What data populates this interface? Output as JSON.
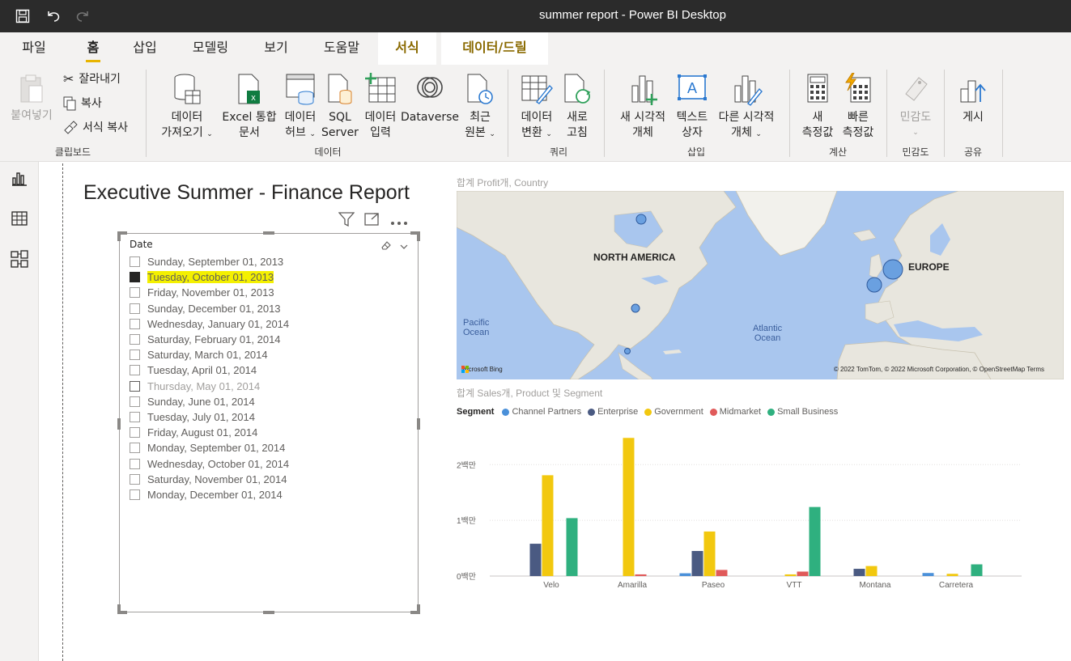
{
  "window": {
    "title": "summer report - Power BI Desktop"
  },
  "tabs": [
    {
      "label": "파일"
    },
    {
      "label": "홈"
    },
    {
      "label": "삽입"
    },
    {
      "label": "모델링"
    },
    {
      "label": "보기"
    },
    {
      "label": "도움말"
    },
    {
      "label": "서식"
    },
    {
      "label": "데이터/드릴"
    }
  ],
  "ribbon": {
    "clipboard": {
      "paste_label": "붙여넣기",
      "cut_label": "잘라내기",
      "copy_label": "복사",
      "format_copy_label": "서식 복사",
      "group_label": "클립보드"
    },
    "data": {
      "get_data_l1": "데이터",
      "get_data_l2": "가져오기",
      "excel_l1": "Excel 통합",
      "excel_l2": "문서",
      "hub_l1": "데이터",
      "hub_l2": "허브",
      "sql_l1": "SQL",
      "sql_l2": "Server",
      "enter_l1": "데이터",
      "enter_l2": "입력",
      "dataverse": "Dataverse",
      "recent_l1": "최근",
      "recent_l2": "원본",
      "group_label": "데이터"
    },
    "query": {
      "transform_l1": "데이터",
      "transform_l2": "변환",
      "refresh_l1": "새로",
      "refresh_l2": "고침",
      "group_label": "쿼리"
    },
    "insert": {
      "newvis_l1": "새 시각적",
      "newvis_l2": "개체",
      "textbox_l1": "텍스트",
      "textbox_l2": "상자",
      "morevis_l1": "다른 시각적",
      "morevis_l2": "개체",
      "group_label": "삽입"
    },
    "calc": {
      "newmeasure_l1": "새",
      "newmeasure_l2": "측정값",
      "quick_l1": "빠른",
      "quick_l2": "측정값",
      "group_label": "계산"
    },
    "sensitivity": {
      "label": "민감도",
      "group_label": "민감도"
    },
    "share": {
      "publish_label": "게시",
      "group_label": "공유"
    }
  },
  "report": {
    "title": "Executive Summer - Finance Report"
  },
  "slicer": {
    "header": "Date",
    "items": [
      {
        "label": "Sunday, September 01, 2013",
        "checked": false
      },
      {
        "label": "Tuesday, October 01, 2013",
        "checked": true
      },
      {
        "label": "Friday, November 01, 2013",
        "checked": false
      },
      {
        "label": "Sunday, December 01, 2013",
        "checked": false
      },
      {
        "label": "Wednesday, January 01, 2014",
        "checked": false
      },
      {
        "label": "Saturday, February 01, 2014",
        "checked": false
      },
      {
        "label": "Saturday, March 01, 2014",
        "checked": false
      },
      {
        "label": "Tuesday, April 01, 2014",
        "checked": false
      },
      {
        "label": "Thursday, May 01, 2014",
        "checked": false
      },
      {
        "label": "Sunday, June 01, 2014",
        "checked": false
      },
      {
        "label": "Tuesday, July 01, 2014",
        "checked": false
      },
      {
        "label": "Friday, August 01, 2014",
        "checked": false
      },
      {
        "label": "Monday, September 01, 2014",
        "checked": false
      },
      {
        "label": "Wednesday, October 01, 2014",
        "checked": false
      },
      {
        "label": "Saturday, November 01, 2014",
        "checked": false
      },
      {
        "label": "Monday, December 01, 2014",
        "checked": false
      }
    ]
  },
  "map": {
    "title": "합계 Profit개, Country",
    "label_na": "NORTH AMERICA",
    "label_eu": "EUROPE",
    "pacific_l1": "Pacific",
    "pacific_l2": "Ocean",
    "atlantic_l1": "Atlantic",
    "atlantic_l2": "Ocean",
    "bing": "Microsoft Bing",
    "copyright": "© 2022 TomTom, © 2022 Microsoft Corporation, © OpenStreetMap  Terms"
  },
  "chart": {
    "title": "합계  Sales개, Product 및 Segment",
    "legend_title": "Segment"
  },
  "colors": {
    "accent": "#e8b400",
    "highlight": "#f4f000",
    "channel_partners": "#4a90d9",
    "enterprise": "#4a5a82",
    "government": "#f2c80f",
    "midmarket": "#e05a5a",
    "small_business": "#2fb07f"
  },
  "chart_data": {
    "type": "bar",
    "categories": [
      "Velo",
      "Amarilla",
      "Paseo",
      "VTT",
      "Montana",
      "Carretera"
    ],
    "y_ticks": [
      "0백만",
      "1백만",
      "2백만"
    ],
    "ylim": [
      0,
      2600000
    ],
    "series": [
      {
        "name": "Channel Partners",
        "color": "#4a90d9",
        "values": [
          0,
          0,
          50000,
          0,
          0,
          55000
        ]
      },
      {
        "name": "Enterprise",
        "color": "#4a5a82",
        "values": [
          580000,
          0,
          450000,
          0,
          130000,
          0
        ]
      },
      {
        "name": "Government",
        "color": "#f2c80f",
        "values": [
          1810000,
          2480000,
          800000,
          30000,
          180000,
          40000
        ]
      },
      {
        "name": "Midmarket",
        "color": "#e05a5a",
        "values": [
          0,
          30000,
          110000,
          80000,
          0,
          0
        ]
      },
      {
        "name": "Small Business",
        "color": "#2fb07f",
        "values": [
          1040000,
          0,
          0,
          1240000,
          0,
          210000
        ]
      }
    ]
  }
}
